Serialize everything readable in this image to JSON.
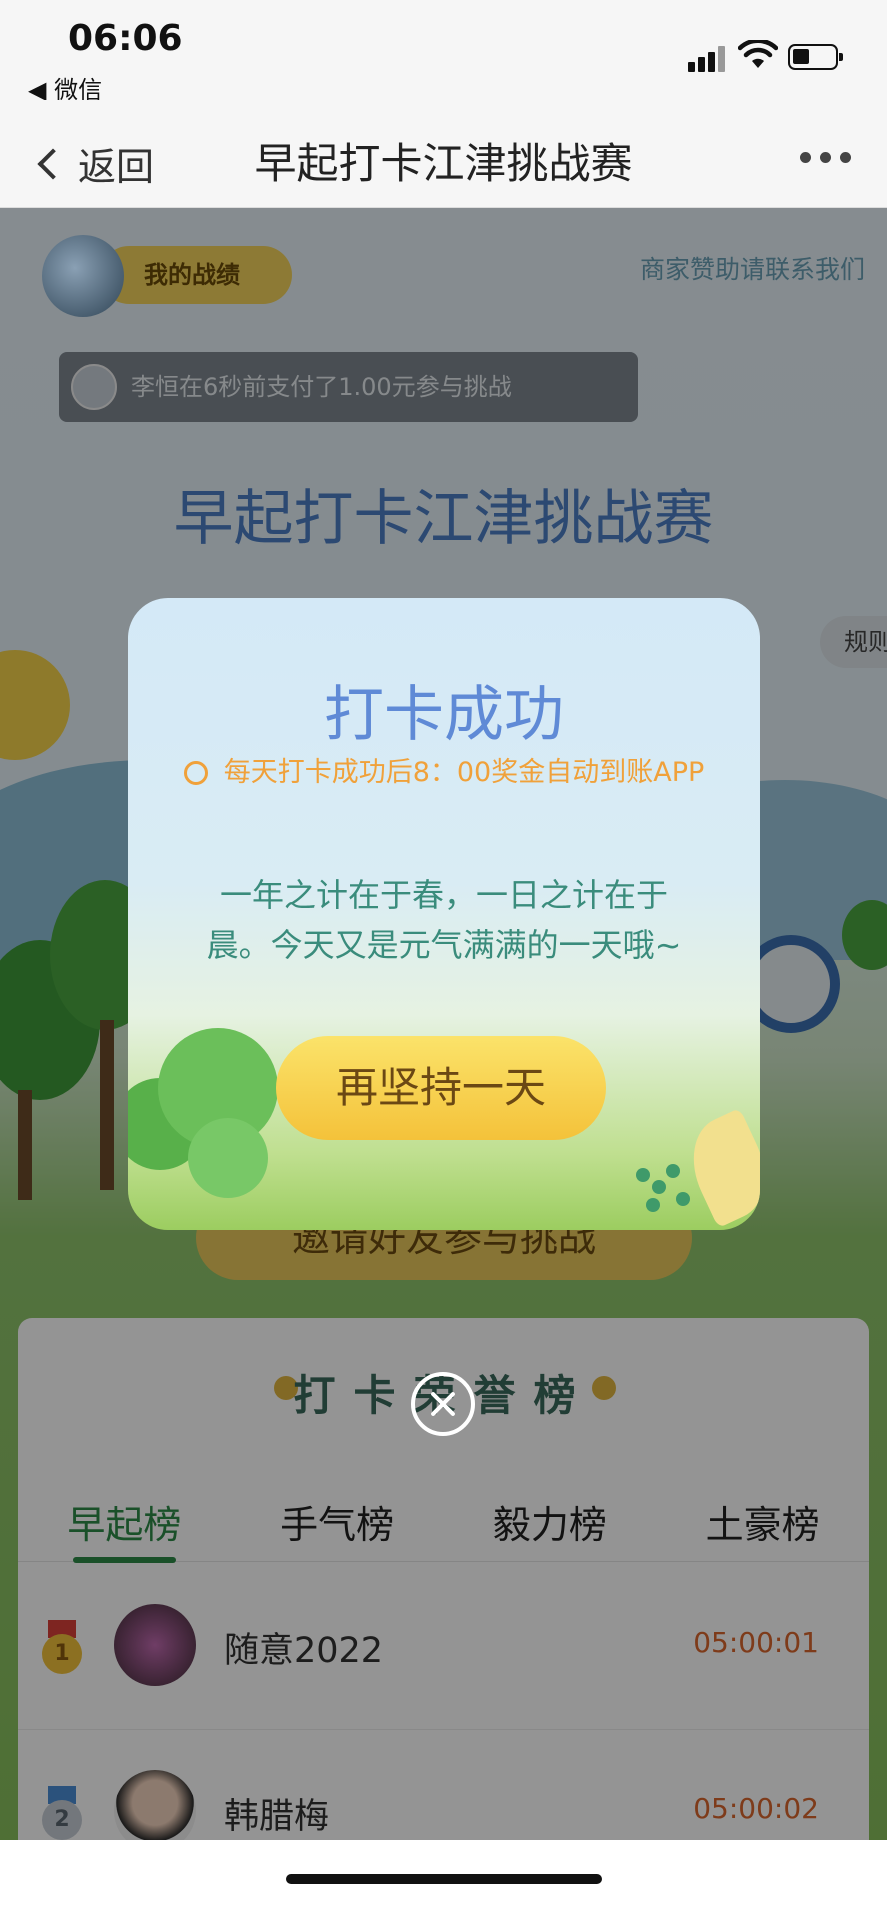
{
  "status_bar": {
    "time": "06:06",
    "back_app": "◀ 微信"
  },
  "nav": {
    "back_label": "返回",
    "title": "早起打卡江津挑战赛"
  },
  "header": {
    "my_record": "我的战绩",
    "sponsor_link": "商家赞助请联系我们"
  },
  "ticker": {
    "text": "李恒在6秒前支付了1.00元参与挑战"
  },
  "page_title": "早起打卡江津挑战赛",
  "rules_label": "规则",
  "invite_button": "邀请好友参与挑战",
  "modal": {
    "title": "打卡成功",
    "note": "每天打卡成功后8：00奖金自动到账APP",
    "message": "一年之计在于春，一日之计在于晨。今天又是元气满满的一天哦~",
    "button": "再坚持一天"
  },
  "board": {
    "title": "打卡荣誉榜",
    "tabs": [
      {
        "label": "早起榜",
        "active": true
      },
      {
        "label": "手气榜",
        "active": false
      },
      {
        "label": "毅力榜",
        "active": false
      },
      {
        "label": "土豪榜",
        "active": false
      }
    ],
    "rows": [
      {
        "rank": "1",
        "name": "随意2022",
        "time": "05:00:01"
      },
      {
        "rank": "2",
        "name": "韩腊梅",
        "time": "05:00:02"
      }
    ]
  },
  "colors": {
    "accent_green": "#2d8a48",
    "gold": "#f4c23a",
    "title_blue": "#5f8ad6",
    "time_orange": "#d9672e"
  }
}
